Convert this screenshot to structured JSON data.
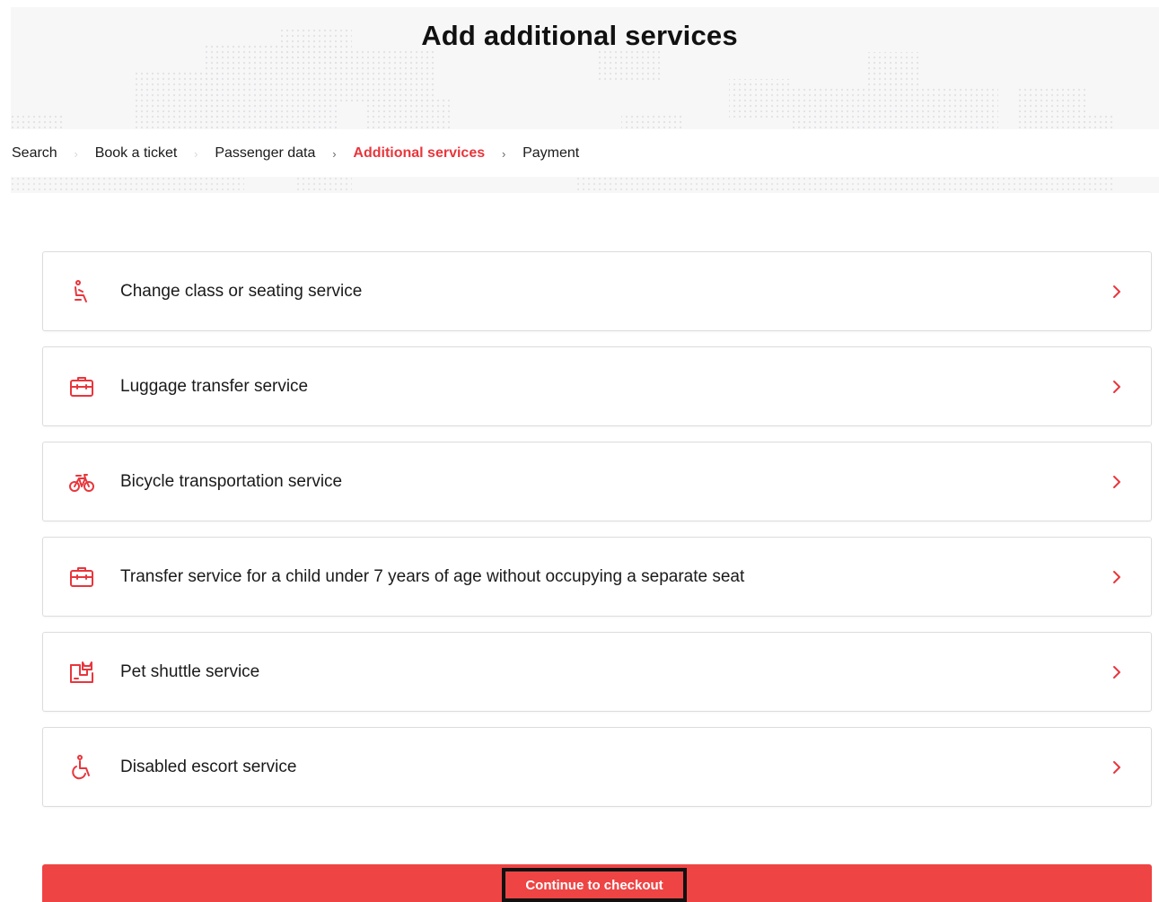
{
  "page": {
    "title": "Add additional services"
  },
  "breadcrumb": {
    "items": [
      {
        "label": "Search",
        "state": "done"
      },
      {
        "label": "Book a ticket",
        "state": "done"
      },
      {
        "label": "Passenger data",
        "state": "done"
      },
      {
        "label": "Additional services",
        "state": "current"
      },
      {
        "label": "Payment",
        "state": "upcoming"
      }
    ],
    "separator": "›"
  },
  "services": [
    {
      "label": "Change class or seating service",
      "icon": "seat-icon"
    },
    {
      "label": "Luggage transfer service",
      "icon": "luggage-icon"
    },
    {
      "label": "Bicycle transportation service",
      "icon": "bicycle-icon"
    },
    {
      "label": "Transfer service for a child under 7 years of age without occupying a separate seat",
      "icon": "luggage-icon"
    },
    {
      "label": "Pet shuttle service",
      "icon": "pet-icon"
    },
    {
      "label": "Disabled escort service",
      "icon": "wheelchair-icon"
    }
  ],
  "checkout": {
    "label": "Continue to checkout"
  },
  "colors": {
    "accent": "#e8363c",
    "button": "#ef4444",
    "border": "#dcdcdc",
    "background_band": "#f7f7f8"
  }
}
